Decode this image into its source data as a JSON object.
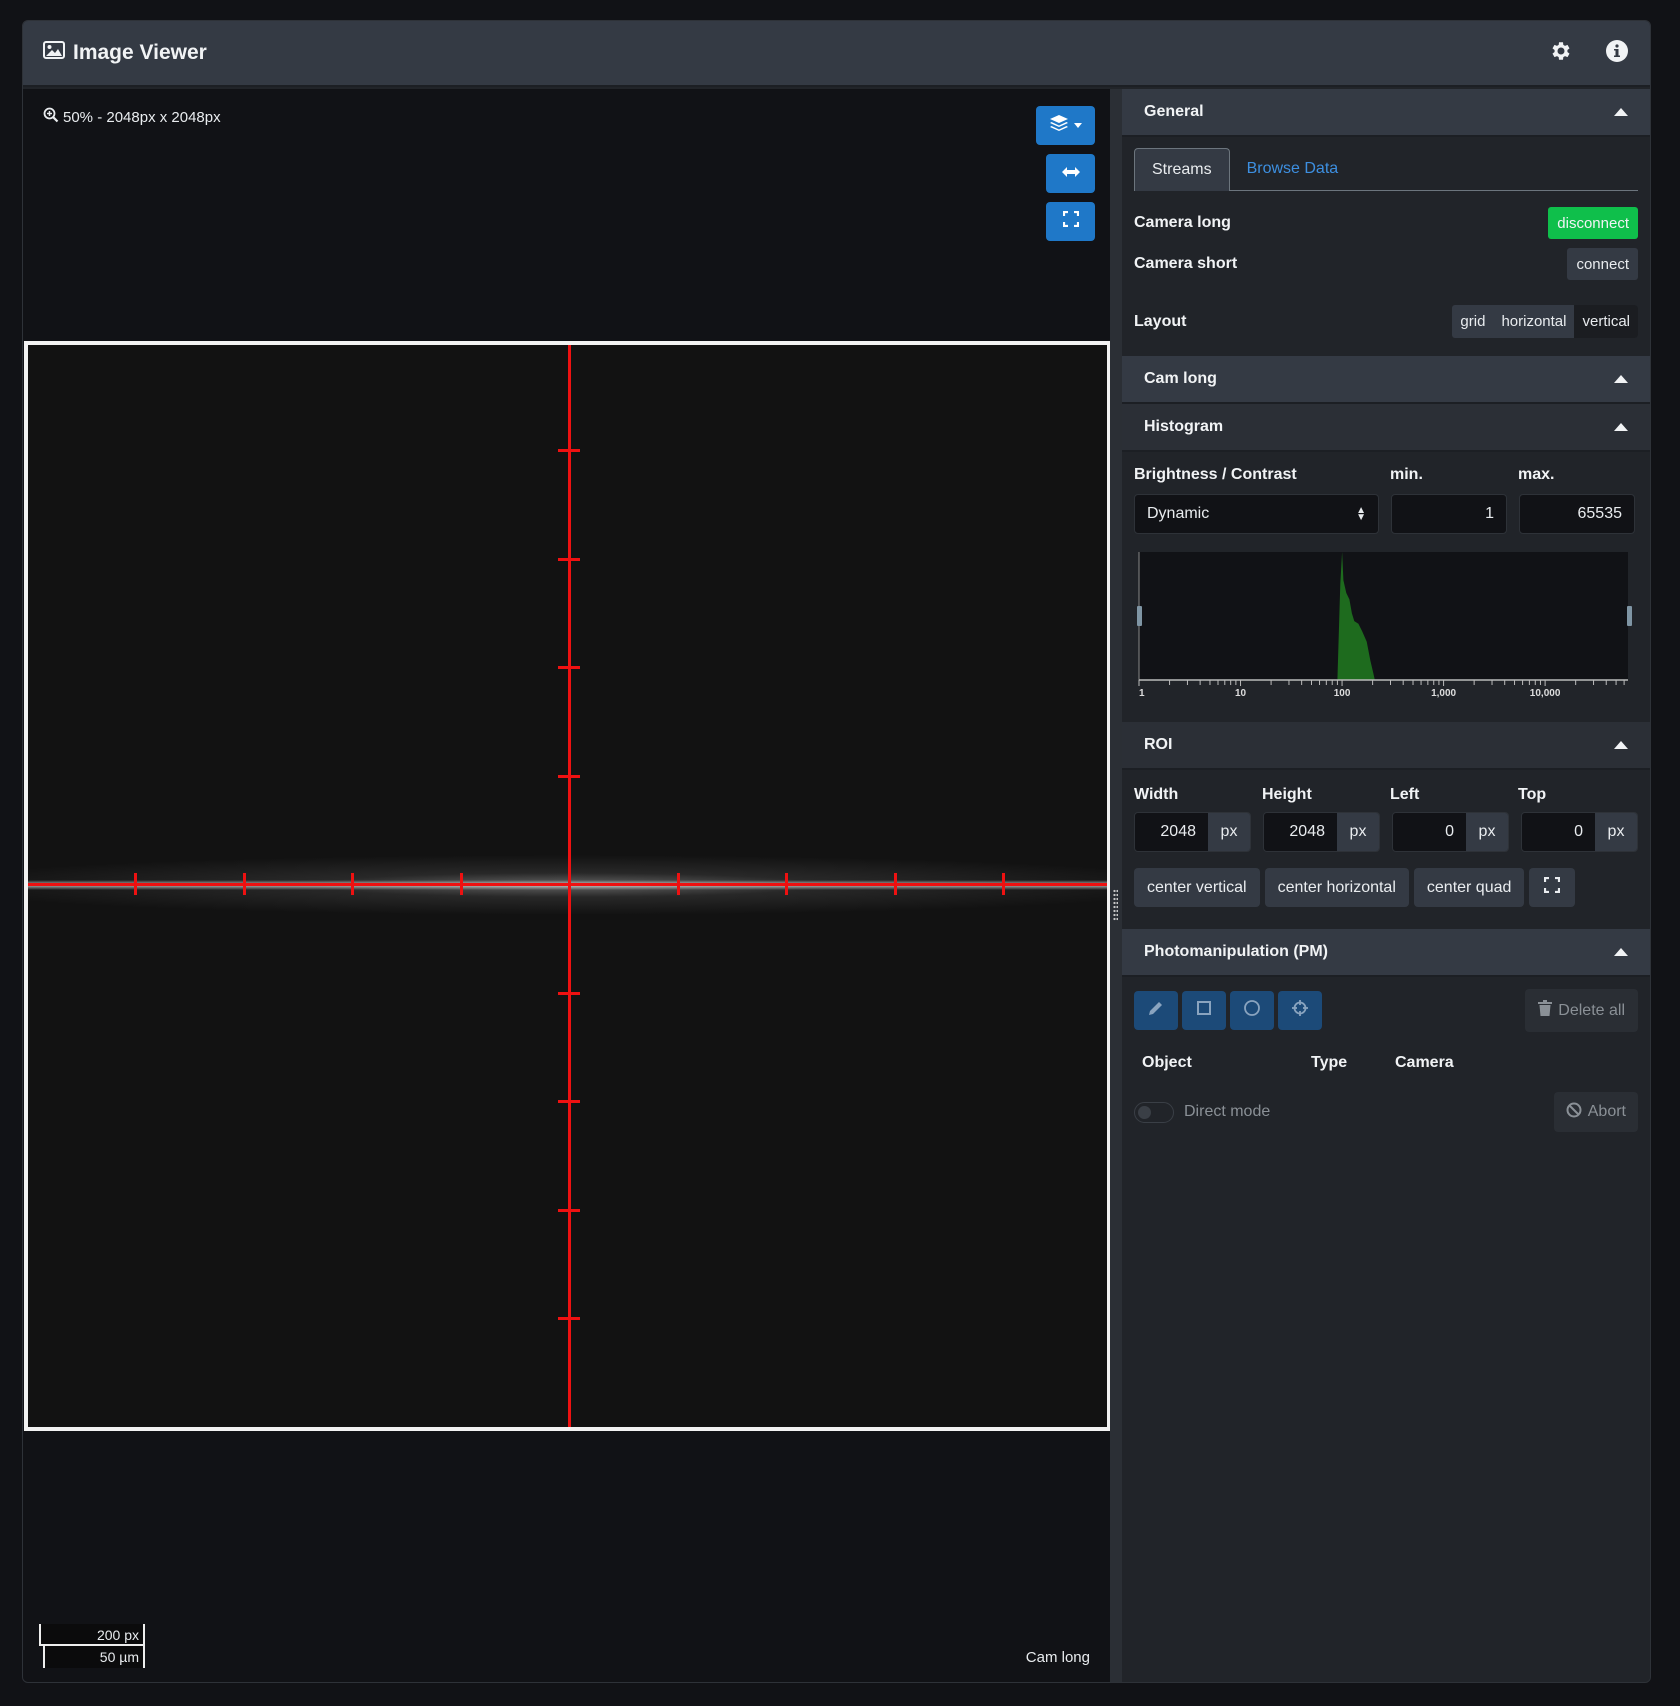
{
  "app": {
    "title": "Image Viewer",
    "icons": {
      "title": "image-icon",
      "settings": "gear-icon",
      "info": "info-icon"
    }
  },
  "viewer": {
    "zoom_readout": "50% - 2048px x 2048px",
    "buttons": {
      "layers": "layers-dropdown-button",
      "swap": "swap-horizontal-button",
      "fullscreen": "fullscreen-button"
    },
    "scalebar": {
      "pixels": "200 px",
      "micrometers": "50 µm"
    },
    "camera_label": "Cam long",
    "crosshair_color": "#ee1111"
  },
  "sidebar": {
    "general": {
      "title": "General",
      "tabs": [
        {
          "label": "Streams",
          "active": true
        },
        {
          "label": "Browse Data",
          "active": false
        }
      ],
      "cameras": [
        {
          "name": "Camera long",
          "action": "disconnect",
          "connected": true
        },
        {
          "name": "Camera short",
          "action": "connect",
          "connected": false
        }
      ],
      "layout": {
        "label": "Layout",
        "options": [
          "grid",
          "horizontal",
          "vertical"
        ],
        "selected": "vertical"
      }
    },
    "cam_long": {
      "title": "Cam long"
    },
    "histogram": {
      "title": "Histogram",
      "brightness_label": "Brightness / Contrast",
      "min_label": "min.",
      "max_label": "max.",
      "mode": "Dynamic",
      "min_value": "1",
      "max_value": "65535",
      "axis_labels": [
        "1",
        "10",
        "100",
        "1,000",
        "10,000"
      ],
      "fill_color": "#1e6b1e"
    },
    "roi": {
      "title": "ROI",
      "fields": [
        {
          "label": "Width",
          "value": "2048",
          "unit": "px"
        },
        {
          "label": "Height",
          "value": "2048",
          "unit": "px"
        },
        {
          "label": "Left",
          "value": "0",
          "unit": "px"
        },
        {
          "label": "Top",
          "value": "0",
          "unit": "px"
        }
      ],
      "buttons": [
        "center vertical",
        "center horizontal",
        "center quad"
      ]
    },
    "pm": {
      "title": "Photomanipulation (PM)",
      "tools": [
        "pencil-icon",
        "square-icon",
        "circle-icon",
        "crosshair-icon"
      ],
      "delete_all": "Delete all",
      "columns": [
        "Object",
        "Type",
        "Camera"
      ],
      "direct_mode": "Direct mode",
      "direct_mode_on": false,
      "abort": "Abort"
    }
  }
}
